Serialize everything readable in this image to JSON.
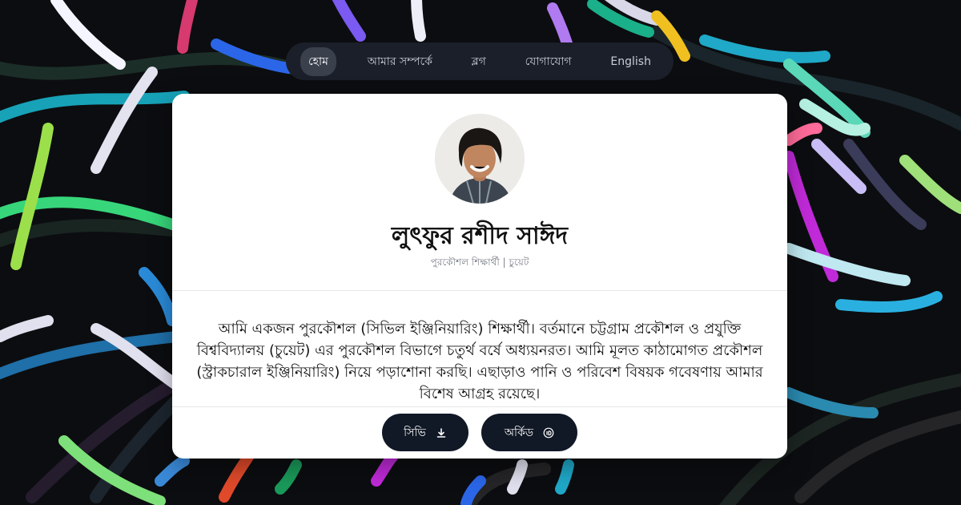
{
  "nav": {
    "items": [
      {
        "label": "হোম",
        "active": true
      },
      {
        "label": "আমার সম্পর্কে",
        "active": false
      },
      {
        "label": "ব্লগ",
        "active": false
      },
      {
        "label": "যোগাযোগ",
        "active": false
      },
      {
        "label": "English",
        "active": false
      }
    ]
  },
  "profile": {
    "name": "লুৎফুর রশীদ সাঈদ",
    "tagline": "পুরকৌশল শিক্ষার্থী | চুয়েট",
    "bio": "আমি একজন পুরকৌশল (সিভিল ইঞ্জিনিয়ারিং) শিক্ষার্থী। বর্তমানে চট্টগ্রাম প্রকৌশল ও প্রযুক্তি বিশ্ববিদ্যালয় (চুয়েট) এর পুরকৌশল বিভাগে চতুর্থ বর্ষে অধ্যয়নরত। আমি মূলত কাঠামোগত প্রকৌশল (স্ট্রাকচারাল ইঞ্জিনিয়ারিং) নিয়ে পড়াশোনা করছি। এছাড়াও পানি ও পরিবেশ বিষয়ক গবেষণায় আমার বিশেষ আগ্রহ রয়েছে।"
  },
  "actions": {
    "cv_label": "সিভি",
    "cv_icon": "download-icon",
    "orcid_label": "অর্কিড",
    "orcid_icon": "orcid-icon"
  },
  "colors": {
    "background": "#0c0d10",
    "nav_bg": "#1b1f29",
    "nav_active": "#3a404c",
    "card": "#ffffff",
    "button": "#111826"
  }
}
